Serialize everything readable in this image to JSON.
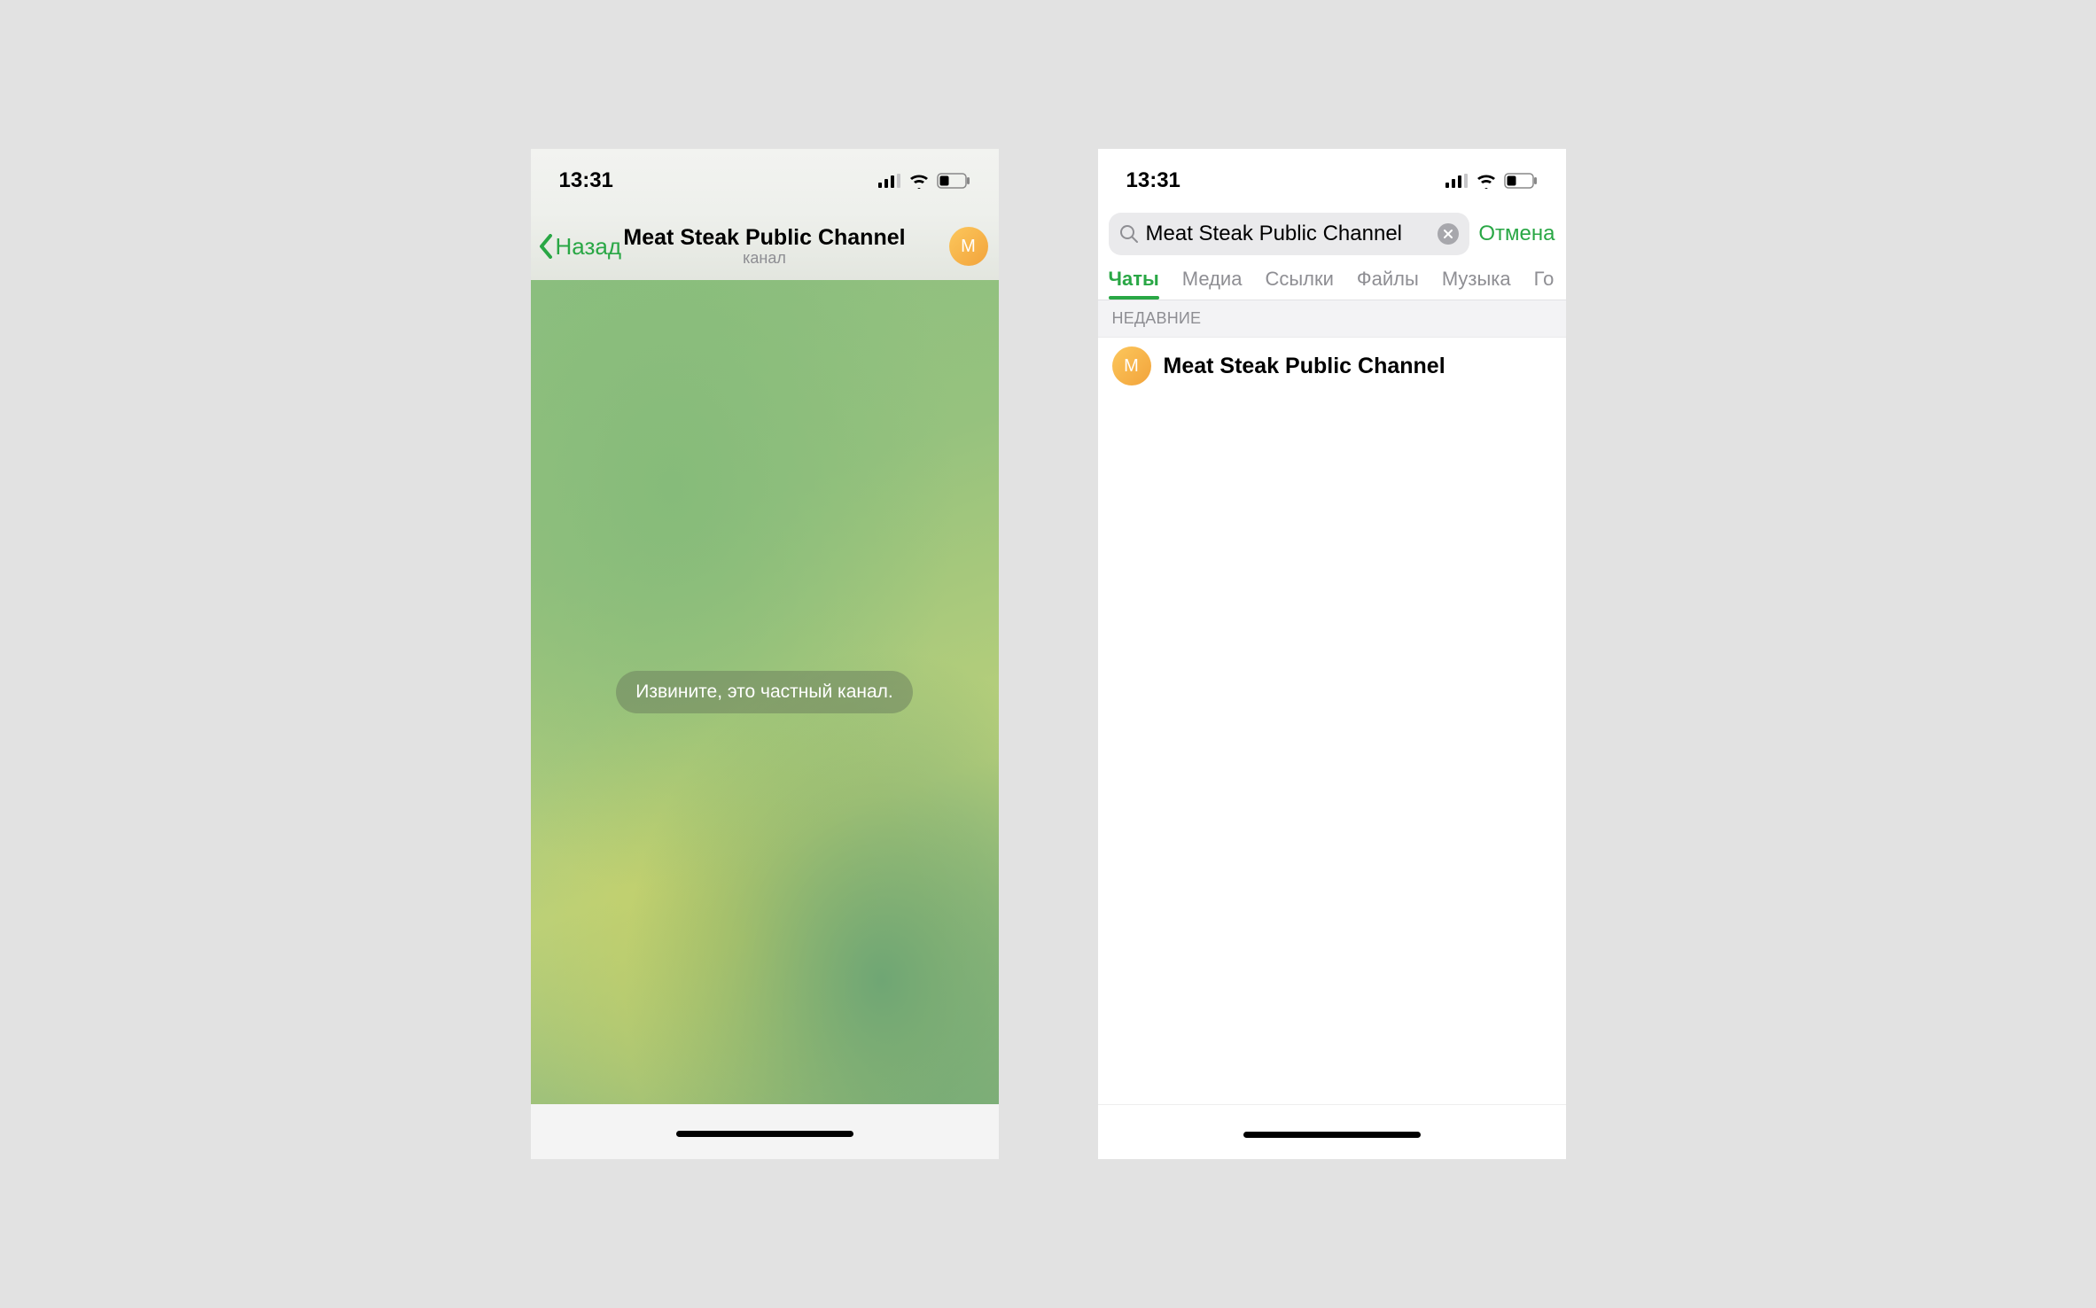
{
  "status": {
    "time": "13:31"
  },
  "left": {
    "back_label": "Назад",
    "channel_title": "Meat Steak Public Channel",
    "channel_subtitle": "канал",
    "avatar_letter": "M",
    "center_message": "Извините, это частный канал."
  },
  "right": {
    "search_value": "Meat Steak Public Channel",
    "cancel_label": "Отмена",
    "tabs": [
      "Чаты",
      "Медиа",
      "Ссылки",
      "Файлы",
      "Музыка",
      "Го"
    ],
    "section_label": "НЕДАВНИЕ",
    "result": {
      "avatar_letter": "M",
      "name": "Meat Steak Public Channel"
    }
  }
}
